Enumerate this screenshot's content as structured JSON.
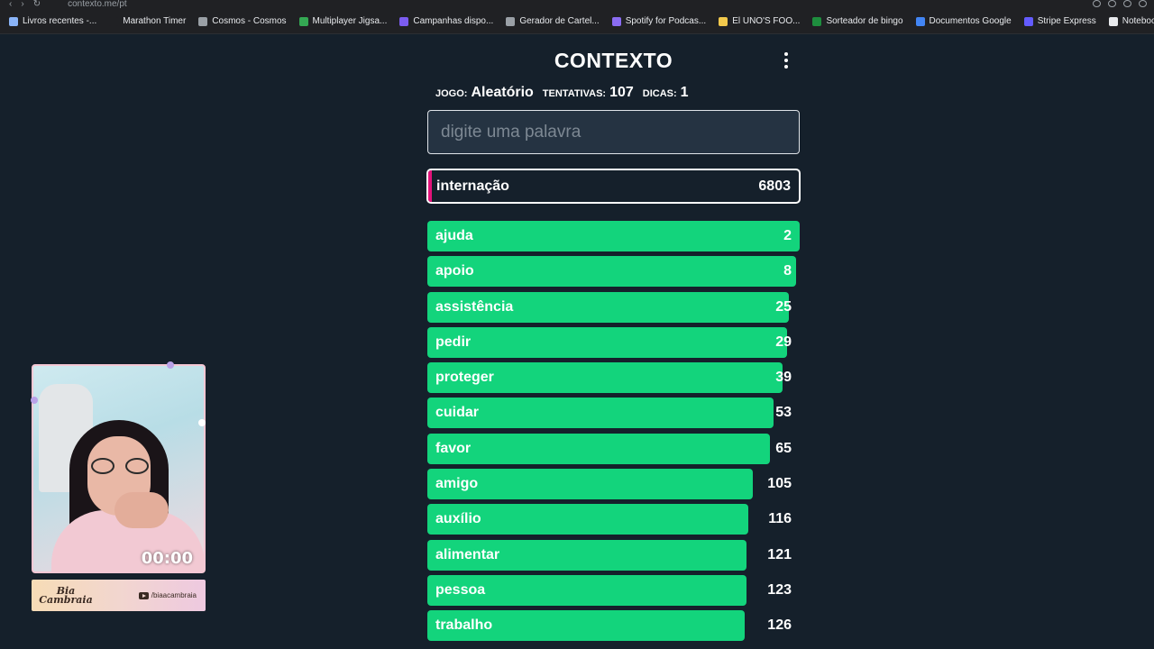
{
  "browser": {
    "url": "contexto.me/pt",
    "bookmarks": [
      {
        "label": "Livros recentes -...",
        "icon": "livros-icon",
        "color": "#8ab4f8"
      },
      {
        "label": "Marathon Timer",
        "icon": "blank-icon",
        "color": "#202124"
      },
      {
        "label": "Cosmos - Cosmos",
        "icon": "page-icon",
        "color": "#9aa0a6"
      },
      {
        "label": "Multiplayer Jigsa...",
        "icon": "puzzle-icon",
        "color": "#34a853"
      },
      {
        "label": "Campanhas dispo...",
        "icon": "campaign-icon",
        "color": "#7b5cf0"
      },
      {
        "label": "Gerador de Cartel...",
        "icon": "page-icon",
        "color": "#9aa0a6"
      },
      {
        "label": "Spotify for Podcas...",
        "icon": "spotify-icon",
        "color": "#8a6cf2"
      },
      {
        "label": "El UNO'S FOO...",
        "icon": "uno-icon",
        "color": "#f2c94c"
      },
      {
        "label": "Sorteador de bingo",
        "icon": "bingo-icon",
        "color": "#1e8e3e"
      },
      {
        "label": "Documentos Google",
        "icon": "docs-icon",
        "color": "#4285f4"
      },
      {
        "label": "Stripe Express",
        "icon": "stripe-icon",
        "color": "#635bff"
      },
      {
        "label": "NotebookLM",
        "icon": "notebooklm-icon",
        "color": "#e8eaed"
      }
    ]
  },
  "game": {
    "title": "CONTEXTO",
    "info": {
      "game_label": "JOGO:",
      "game_value": "Aleatório",
      "attempts_label": "TENTATIVAS:",
      "attempts_value": "107",
      "hints_label": "DICAS:",
      "hints_value": "1"
    },
    "input_placeholder": "digite uma palavra",
    "last_guess": {
      "word": "internação",
      "rank": "6803",
      "color": "#e3127a"
    },
    "guesses": [
      {
        "word": "ajuda",
        "rank": "2",
        "fill": 1.0
      },
      {
        "word": "apoio",
        "rank": "8",
        "fill": 0.99
      },
      {
        "word": "assistência",
        "rank": "25",
        "fill": 0.97
      },
      {
        "word": "pedir",
        "rank": "29",
        "fill": 0.965
      },
      {
        "word": "proteger",
        "rank": "39",
        "fill": 0.955
      },
      {
        "word": "cuidar",
        "rank": "53",
        "fill": 0.93
      },
      {
        "word": "favor",
        "rank": "65",
        "fill": 0.92
      },
      {
        "word": "amigo",
        "rank": "105",
        "fill": 0.875
      },
      {
        "word": "auxílio",
        "rank": "116",
        "fill": 0.862
      },
      {
        "word": "alimentar",
        "rank": "121",
        "fill": 0.858
      },
      {
        "word": "pessoa",
        "rank": "123",
        "fill": 0.856
      },
      {
        "word": "trabalho",
        "rank": "126",
        "fill": 0.853
      }
    ],
    "bar_color": "#13d47c"
  },
  "webcam": {
    "timer": "00:00",
    "logo_line1": "Bia",
    "logo_line2": "Cambraia",
    "handle": "/biaacambraia"
  }
}
